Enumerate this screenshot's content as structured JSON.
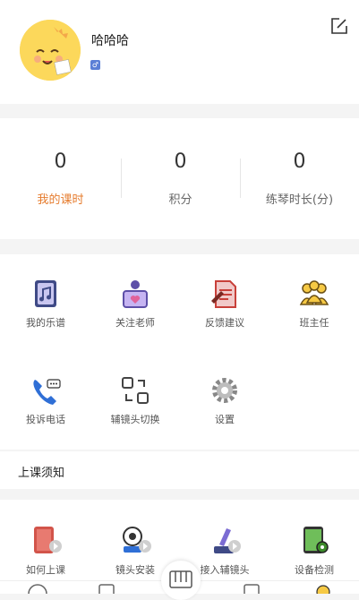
{
  "profile": {
    "username": "哈哈哈",
    "gender_symbol": "♂"
  },
  "stats": [
    {
      "value": "0",
      "label": "我的课时"
    },
    {
      "value": "0",
      "label": "积分"
    },
    {
      "value": "0",
      "label": "练琴时长(分)"
    }
  ],
  "features": [
    {
      "label": "我的乐谱",
      "icon": "music-score-icon"
    },
    {
      "label": "关注老师",
      "icon": "follow-teacher-icon"
    },
    {
      "label": "反馈建议",
      "icon": "feedback-icon"
    },
    {
      "label": "班主任",
      "icon": "head-teacher-icon"
    },
    {
      "label": "投诉电话",
      "icon": "phone-icon"
    },
    {
      "label": "辅镜头切换",
      "icon": "camera-switch-icon"
    },
    {
      "label": "设置",
      "icon": "gear-icon"
    }
  ],
  "notice": {
    "title": "上课须知"
  },
  "tutorials": [
    {
      "label": "如何上课",
      "icon": "how-to-class-icon"
    },
    {
      "label": "镜头安装",
      "icon": "camera-install-icon"
    },
    {
      "label": "接入辅镜头",
      "icon": "connect-aux-camera-icon"
    },
    {
      "label": "设备检测",
      "icon": "device-check-icon"
    }
  ],
  "colors": {
    "accent": "#e67c2e",
    "background": "#f4f4f4"
  }
}
